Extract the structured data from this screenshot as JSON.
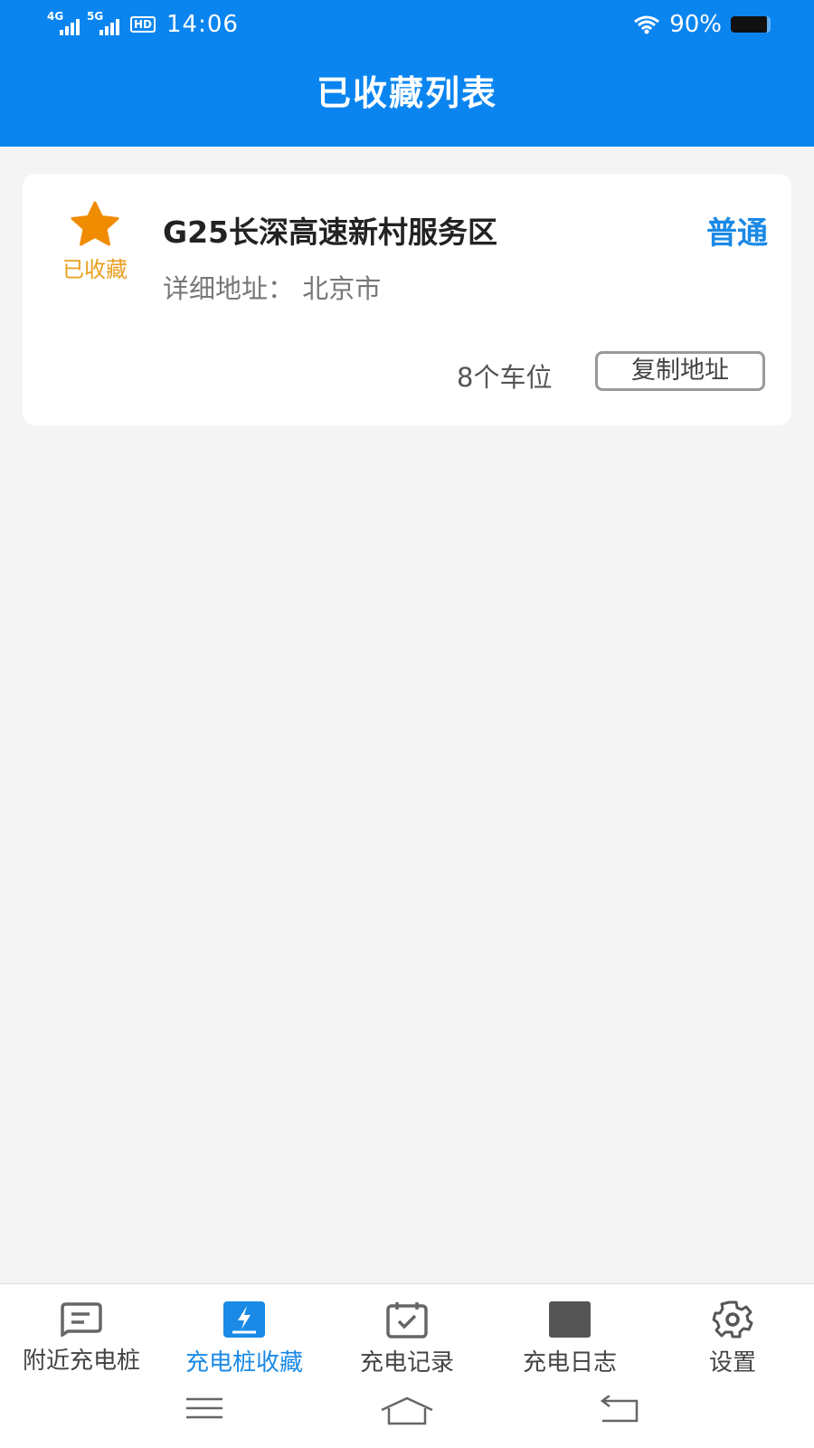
{
  "status_bar": {
    "signal1": "4G",
    "signal2": "5G",
    "hd": "HD",
    "time": "14:06",
    "battery": "90%",
    "battery_level": 0.9
  },
  "header": {
    "title": "已收藏列表"
  },
  "favorites": [
    {
      "fav_label": "已收藏",
      "name": "G25长深高速新村服务区",
      "type": "普通",
      "address": "详细地址： 北京市",
      "slots": "8个车位",
      "copy_button": "复制地址"
    }
  ],
  "tabs": [
    {
      "label": "附近充电桩",
      "icon": "message-icon",
      "active": false
    },
    {
      "label": "充电桩收藏",
      "icon": "charging-icon",
      "active": true
    },
    {
      "label": "充电记录",
      "icon": "calendar-check-icon",
      "active": false
    },
    {
      "label": "充电日志",
      "icon": "log-icon",
      "active": false
    },
    {
      "label": "设置",
      "icon": "gear-icon",
      "active": false
    }
  ],
  "colors": {
    "header": "#0a85f0",
    "accent": "#1a8ae6",
    "favorite": "#f08c00",
    "favorite_text": "#e8a020"
  }
}
